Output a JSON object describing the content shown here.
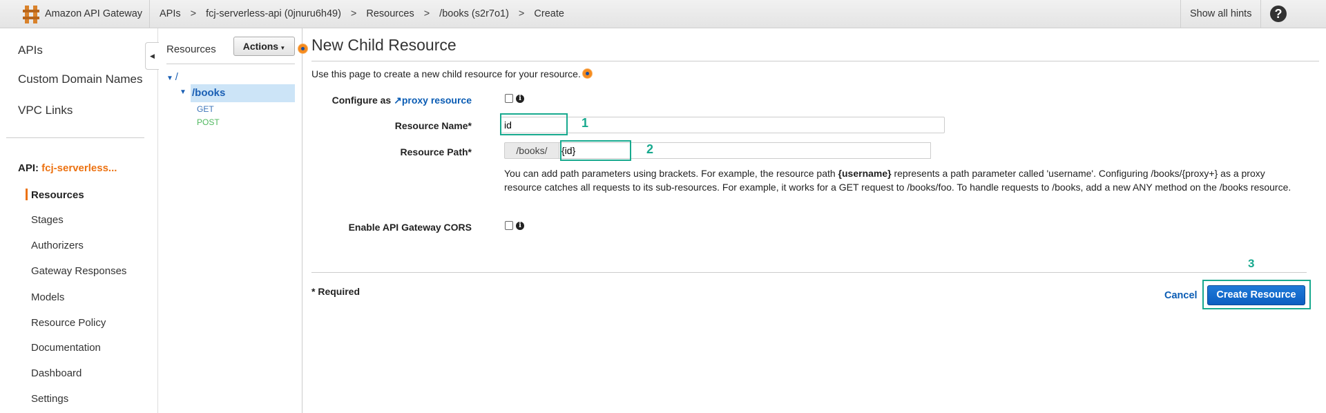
{
  "header": {
    "brand": "Amazon API Gateway",
    "breadcrumbs": [
      "APIs",
      "fcj-serverless-api (0jnuru6h49)",
      "Resources",
      "/books (s2r7o1)",
      "Create"
    ],
    "separator": ">",
    "show_hints": "Show all hints",
    "help_icon": "question-circle-icon"
  },
  "sidebar": {
    "top_items": [
      "APIs",
      "Custom Domain Names",
      "VPC Links"
    ],
    "api_label": "API:",
    "api_name": "fcj-serverless...",
    "items": [
      "Resources",
      "Stages",
      "Authorizers",
      "Gateway Responses",
      "Models",
      "Resource Policy",
      "Documentation",
      "Dashboard",
      "Settings"
    ],
    "active_item": "Resources"
  },
  "resources_panel": {
    "title": "Resources",
    "actions_label": "Actions",
    "tree": {
      "root": "/",
      "child": "/books",
      "methods": [
        {
          "name": "GET",
          "color": "#3b73b9"
        },
        {
          "name": "POST",
          "color": "#4fb85f"
        }
      ]
    }
  },
  "main": {
    "title": "New Child Resource",
    "description": "Use this page to create a new child resource for your resource.",
    "configure_label": "Configure as",
    "proxy_link": "proxy resource",
    "proxy_checked": false,
    "resource_name_label": "Resource Name*",
    "resource_name_value": "id",
    "resource_path_label": "Resource Path*",
    "resource_path_prefix": "/books/",
    "resource_path_value": "{id}",
    "help_text_1a": "You can add path parameters using brackets. For example, the resource path ",
    "help_text_1b": "{username}",
    "help_text_1c": " represents a path parameter called 'username'. Configuring /books/{proxy+} as a proxy",
    "help_text_2": "resource catches all requests to its sub-resources. For example, it works for a GET request to /books/foo. To handle requests to /books, add a new ANY method on the /books resource.",
    "cors_label": "Enable API Gateway CORS",
    "cors_checked": false,
    "required_note": "* Required",
    "cancel_label": "Cancel",
    "create_label": "Create Resource"
  },
  "annotations": [
    "1",
    "2",
    "3"
  ],
  "colors": {
    "annotation": "#17a98e",
    "primary_button": "#0b62c4",
    "link": "#0a5cb4",
    "active": "#ec7211"
  }
}
